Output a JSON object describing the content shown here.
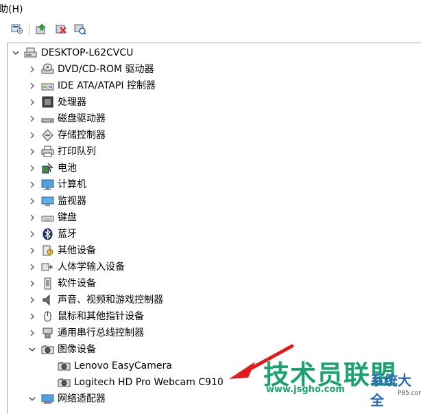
{
  "menubar": {
    "help_menu": "助(H)"
  },
  "tree": {
    "root": "DESKTOP-L62CVCU",
    "categories": [
      {
        "label": "DVD/CD-ROM 驱动器",
        "icon": "dvd-drive-icon"
      },
      {
        "label": "IDE ATA/ATAPI 控制器",
        "icon": "ide-controller-icon"
      },
      {
        "label": "处理器",
        "icon": "processor-icon"
      },
      {
        "label": "磁盘驱动器",
        "icon": "disk-drive-icon"
      },
      {
        "label": "存储控制器",
        "icon": "storage-controller-icon"
      },
      {
        "label": "打印队列",
        "icon": "printer-icon"
      },
      {
        "label": "电池",
        "icon": "battery-icon"
      },
      {
        "label": "计算机",
        "icon": "computer-icon"
      },
      {
        "label": "监视器",
        "icon": "monitor-icon"
      },
      {
        "label": "键盘",
        "icon": "keyboard-icon"
      },
      {
        "label": "蓝牙",
        "icon": "bluetooth-icon"
      },
      {
        "label": "其他设备",
        "icon": "other-device-icon"
      },
      {
        "label": "人体学输入设备",
        "icon": "hid-icon"
      },
      {
        "label": "软件设备",
        "icon": "software-device-icon"
      },
      {
        "label": "声音、视频和游戏控制器",
        "icon": "speaker-icon"
      },
      {
        "label": "鼠标和其他指针设备",
        "icon": "mouse-icon"
      },
      {
        "label": "通用串行总线控制器",
        "icon": "usb-icon"
      }
    ],
    "imaging": {
      "label": "图像设备",
      "children": [
        "Lenovo EasyCamera",
        "Logitech HD Pro Webcam C910"
      ]
    },
    "network": "网络适配器"
  },
  "watermark": {
    "main": "技术员联盟",
    "side": "系统大全",
    "url": "www.jsgho.com",
    "num": "P85.com"
  },
  "colors": {
    "arrow": "#e21c1c",
    "watermark_green": "#1aa36f",
    "watermark_blue": "#2a6bb8"
  }
}
